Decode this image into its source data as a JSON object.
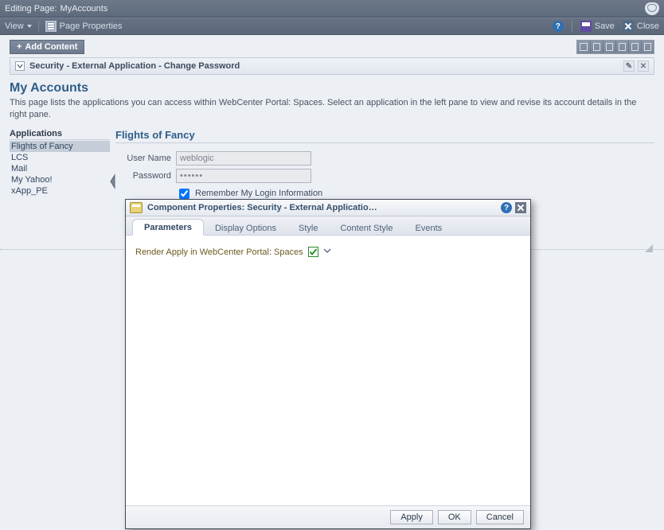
{
  "titlebar": {
    "prefix": "Editing Page:",
    "page_name": "MyAccounts"
  },
  "toolbar": {
    "view_label": "View",
    "page_properties_label": "Page Properties",
    "help_glyph": "?",
    "save_label": "Save",
    "close_label": "Close"
  },
  "addcontent": {
    "plus": "+",
    "label": "Add Content"
  },
  "panel": {
    "title": "Security - External Application - Change Password"
  },
  "page": {
    "title": "My Accounts",
    "description": "This page lists the applications you can access within WebCenter Portal: Spaces. Select an application in the left pane to view and revise its account details in the right pane."
  },
  "sidebar": {
    "title": "Applications",
    "items": [
      {
        "label": "Flights of Fancy",
        "selected": true
      },
      {
        "label": "LCS",
        "selected": false
      },
      {
        "label": "Mail",
        "selected": false
      },
      {
        "label": "My Yahoo!",
        "selected": false
      },
      {
        "label": "xApp_PE",
        "selected": false
      }
    ]
  },
  "main": {
    "section_title": "Flights of Fancy",
    "username_label": "User Name",
    "username_value": "weblogic",
    "password_label": "Password",
    "password_value": "••••••",
    "remember_label": "Remember My Login Information",
    "remember_checked": true
  },
  "dialog": {
    "title": "Component Properties: Security - External Applicatio…",
    "tabs": [
      {
        "label": "Parameters",
        "active": true
      },
      {
        "label": "Display Options",
        "active": false
      },
      {
        "label": "Style",
        "active": false
      },
      {
        "label": "Content Style",
        "active": false
      },
      {
        "label": "Events",
        "active": false
      }
    ],
    "param_label": "Render Apply in WebCenter Portal: Spaces",
    "param_checked": true,
    "buttons": {
      "apply": "Apply",
      "ok": "OK",
      "cancel": "Cancel"
    },
    "help_glyph": "?"
  }
}
